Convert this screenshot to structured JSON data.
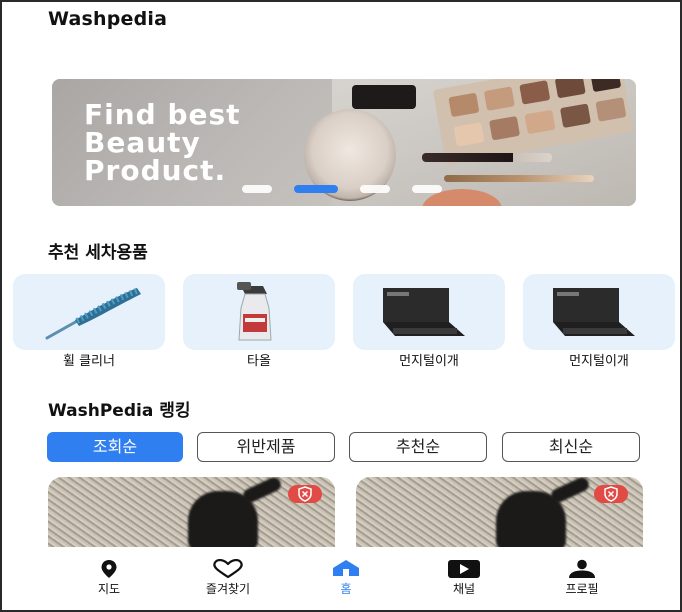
{
  "app": {
    "logo": "Washpedia"
  },
  "banner": {
    "headline_lines": [
      "Find best",
      "Beauty",
      "Product."
    ],
    "slide_count": 4,
    "active_slide": 2
  },
  "recommend": {
    "title": "추천 세차용품",
    "items": [
      {
        "label": "휠 클리너",
        "icon": "duster-icon"
      },
      {
        "label": "타올",
        "icon": "spray-bottle-icon"
      },
      {
        "label": "먼지털이개",
        "icon": "dust-pad-icon"
      },
      {
        "label": "먼지털이개",
        "icon": "dust-pad-icon"
      }
    ]
  },
  "ranking": {
    "title": "WashPedia 랭킹",
    "tabs": [
      "조회순",
      "위반제품",
      "추천순",
      "최신순"
    ],
    "active_tab": 0
  },
  "nav": {
    "items": [
      {
        "label": "지도",
        "icon": "map-pin-icon"
      },
      {
        "label": "즐겨찾기",
        "icon": "heart-icon"
      },
      {
        "label": "홈",
        "icon": "home-icon"
      },
      {
        "label": "채널",
        "icon": "play-icon"
      },
      {
        "label": "프로필",
        "icon": "person-icon"
      }
    ],
    "active_index": 2
  },
  "colors": {
    "accent": "#2f7ff0",
    "badge": "#e24a45",
    "card_bg": "#e6f1fb"
  }
}
